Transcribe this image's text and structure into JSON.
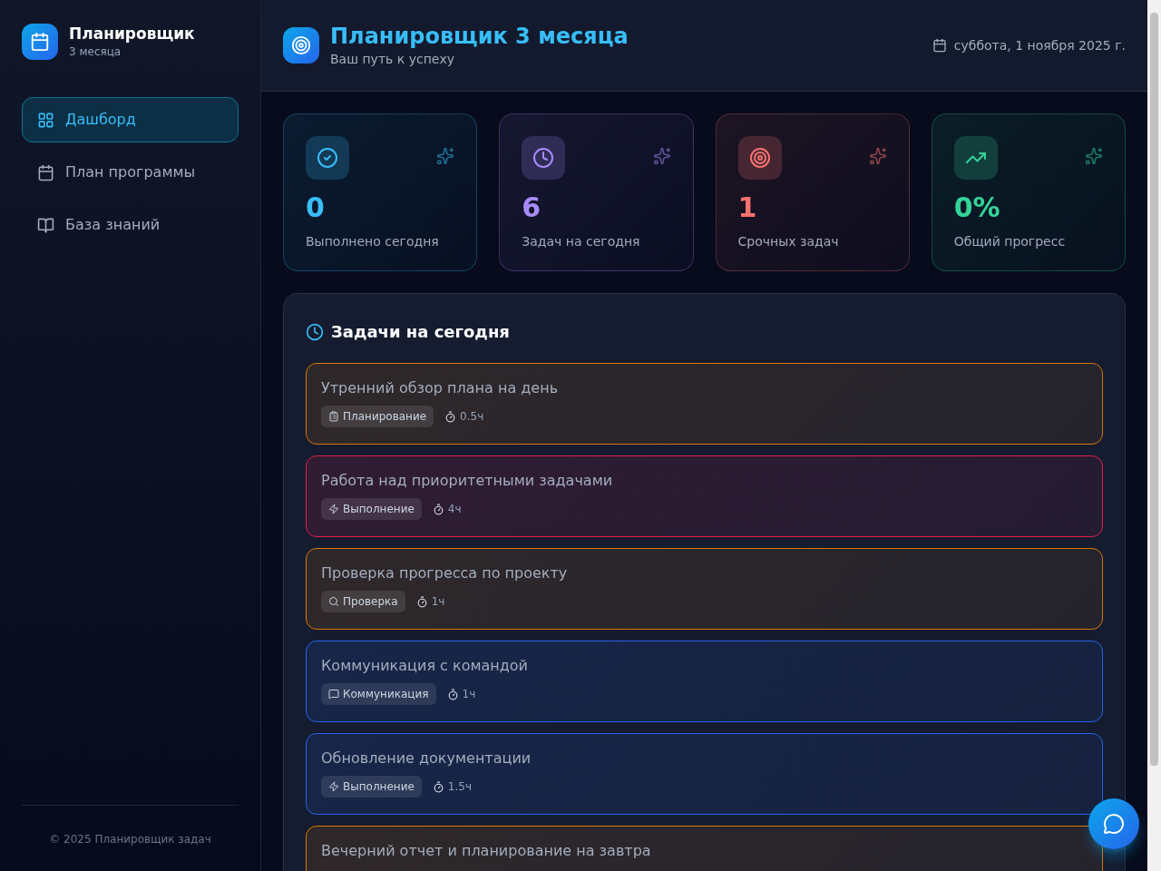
{
  "sidebar": {
    "title": "Планировщик",
    "subtitle": "3 месяца",
    "items": [
      {
        "label": "Дашборд",
        "kind": "grid",
        "selected": true
      },
      {
        "label": "План программы",
        "kind": "calendar",
        "selected": false
      },
      {
        "label": "База знаний",
        "kind": "book",
        "selected": false
      }
    ],
    "footer": "© 2025 Планировщик задач"
  },
  "header": {
    "title": "Планировщик 3 месяца",
    "subtitle": "Ваш путь к успеху",
    "date": "суббота, 1 ноября 2025 г."
  },
  "stats": [
    {
      "value": "0",
      "label": "Выполнено сегодня",
      "kind": "check",
      "color": "#38bdf8"
    },
    {
      "value": "6",
      "label": "Задач на сегодня",
      "kind": "clock",
      "color": "#a78bfa"
    },
    {
      "value": "1",
      "label": "Срочных задач",
      "kind": "target",
      "color": "#f87171"
    },
    {
      "value": "0%",
      "label": "Общий прогресс",
      "kind": "trend",
      "color": "#34d399"
    }
  ],
  "tasks_panel": {
    "title": "Задачи на сегодня",
    "tasks": [
      {
        "title": "Утренний обзор плана на день",
        "tag": "Планирование",
        "kind": "clipboard",
        "duration": "0.5ч",
        "color": "#d97706"
      },
      {
        "title": "Работа над приоритетными задачами",
        "tag": "Выполнение",
        "kind": "zap",
        "duration": "4ч",
        "color": "#e11d48"
      },
      {
        "title": "Проверка прогресса по проекту",
        "tag": "Проверка",
        "kind": "search",
        "duration": "1ч",
        "color": "#d97706"
      },
      {
        "title": "Коммуникация с командой",
        "tag": "Коммуникация",
        "kind": "chat",
        "duration": "1ч",
        "color": "#2563eb"
      },
      {
        "title": "Обновление документации",
        "tag": "Выполнение",
        "kind": "zap",
        "duration": "1.5ч",
        "color": "#2563eb"
      },
      {
        "title": "Вечерний отчет и планирование на завтра",
        "color": "#d97706"
      }
    ]
  }
}
